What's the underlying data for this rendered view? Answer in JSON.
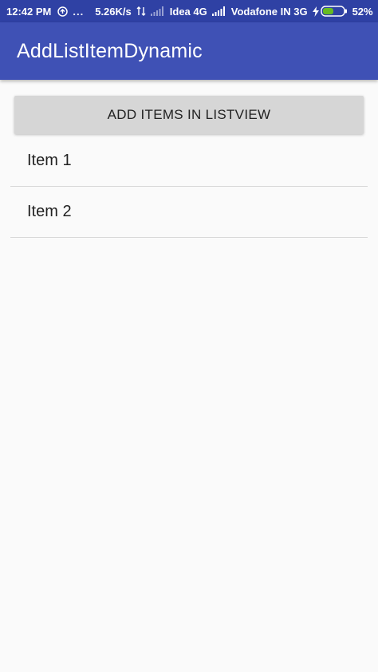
{
  "status_bar": {
    "time": "12:42 PM",
    "dots": "...",
    "network_speed": "5.26K/s",
    "carrier1": "Idea 4G",
    "carrier2": "Vodafone IN 3G",
    "battery": "52%",
    "battery_level": 0.52,
    "icons": [
      "sync-icon",
      "data-arrows-icon",
      "signal-icon",
      "charging-bolt-icon",
      "battery-icon"
    ]
  },
  "app_bar": {
    "title": "AddListItemDynamic"
  },
  "main": {
    "add_button_label": "ADD ITEMS IN LISTVIEW",
    "items": [
      {
        "label": "Item 1"
      },
      {
        "label": "Item 2"
      }
    ]
  },
  "colors": {
    "status_bar": "#2f41a4",
    "app_bar": "#3f51b5",
    "background": "#fafafa",
    "button": "#d6d6d6",
    "battery_fill": "#66bb22"
  }
}
